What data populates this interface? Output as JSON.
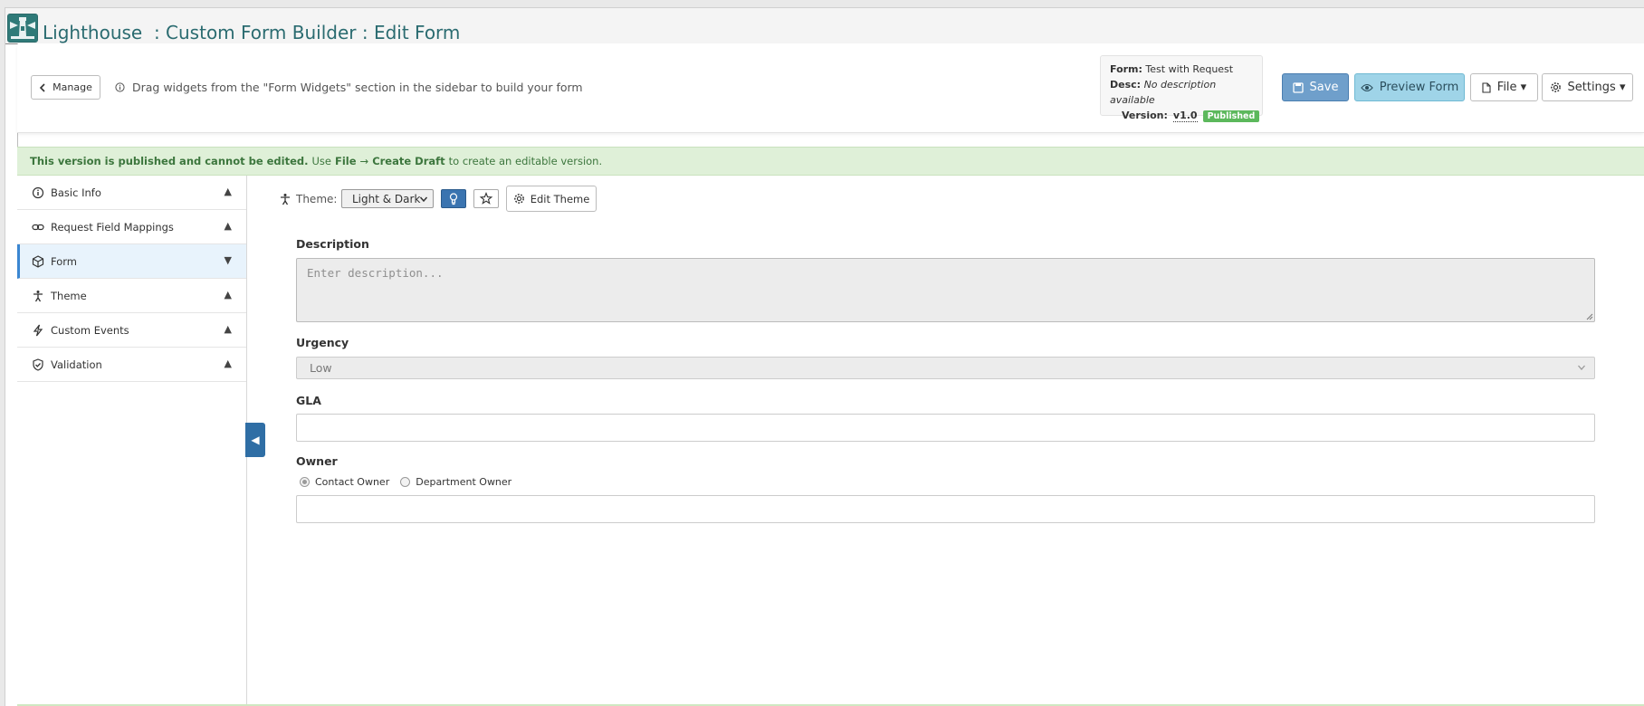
{
  "app": {
    "title": "Lighthouse  : Custom Form Builder : Edit Form"
  },
  "toolbar": {
    "manage_label": "Manage",
    "hint": "Drag widgets from the \"Form Widgets\" section in the sidebar to build your form",
    "info": {
      "form_key": "Form:",
      "form_value": "Test with Request",
      "desc_key": "Desc:",
      "desc_value": "No description available",
      "version_key": "Version:",
      "version_value": "v1.0",
      "status": "Published"
    },
    "save_label": "Save",
    "preview_label": "Preview Form",
    "file_label": "File ▾",
    "settings_label": "Settings ▾"
  },
  "alert": {
    "bold": "This version is published and cannot be edited.",
    "pre": "Use",
    "file": "File",
    "arrow": "→",
    "create": "Create Draft",
    "post": "to create an editable version."
  },
  "sidebar": {
    "items": [
      {
        "label": "Basic Info",
        "icon": "info-icon",
        "arrow": "▲"
      },
      {
        "label": "Request Field Mappings",
        "icon": "link-icon",
        "arrow": "▲"
      },
      {
        "label": "Form",
        "icon": "cube-icon",
        "arrow": "▼"
      },
      {
        "label": "Theme",
        "icon": "accessibility-icon",
        "arrow": "▲"
      },
      {
        "label": "Custom Events",
        "icon": "lightning-icon",
        "arrow": "▲"
      },
      {
        "label": "Validation",
        "icon": "shield-check-icon",
        "arrow": "▲"
      }
    ],
    "collapse_glyph": "◀"
  },
  "theme": {
    "label": "Theme:",
    "selected": "Light & Dark",
    "edit_label": "Edit Theme"
  },
  "form": {
    "description": {
      "label": "Description",
      "placeholder": "Enter description..."
    },
    "urgency": {
      "label": "Urgency",
      "value": "Low"
    },
    "gla": {
      "label": "GLA",
      "value": ""
    },
    "owner": {
      "label": "Owner",
      "options": [
        "Contact Owner",
        "Department Owner"
      ],
      "selected": "Contact Owner",
      "value": ""
    }
  },
  "colors": {
    "title": "#2a6b70",
    "save": "#6f9fcb",
    "preview": "#9fd4e8",
    "published_badge": "#5cb85c",
    "alert_bg": "#dff0d8",
    "active_item": "#e8f3fc"
  }
}
